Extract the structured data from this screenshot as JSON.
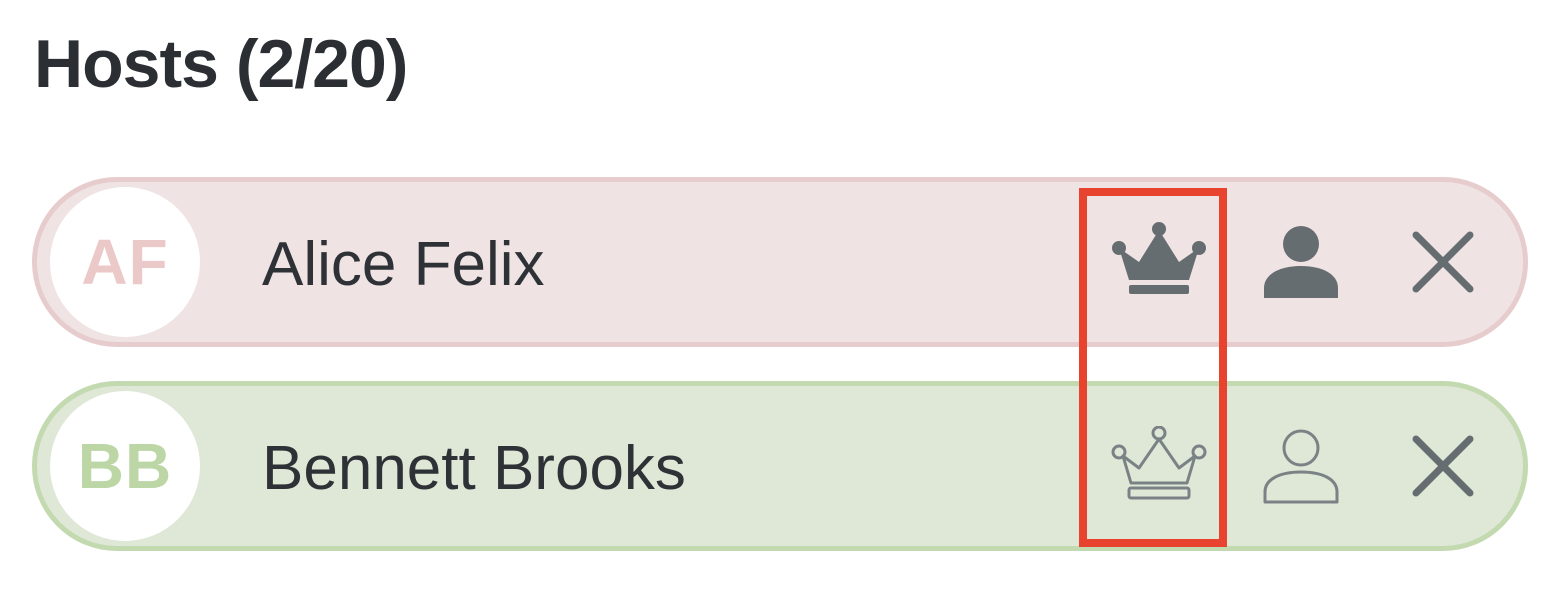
{
  "header": {
    "title": "Hosts (2/20)"
  },
  "hosts": [
    {
      "initials": "AF",
      "name": "Alice Felix",
      "row_color": "#f0e3e4",
      "initials_color": "#ecc9c9",
      "crown_icon": "crown-filled-icon",
      "user_icon": "user-filled-icon",
      "remove_icon": "close-icon"
    },
    {
      "initials": "BB",
      "name": "Bennett Brooks",
      "row_color": "#dfe8d6",
      "initials_color": "#bcd6a6",
      "crown_icon": "crown-outline-icon",
      "user_icon": "user-outline-icon",
      "remove_icon": "close-icon"
    }
  ],
  "colors": {
    "icon": "#666d71",
    "highlight": "#e8432e",
    "text": "#2e3236"
  }
}
